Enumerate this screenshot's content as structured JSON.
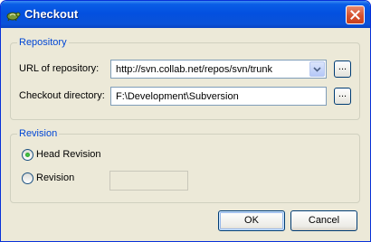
{
  "window": {
    "title": "Checkout",
    "app_icon": "tortoise-svn-icon",
    "close_icon": "close-icon"
  },
  "repository": {
    "legend": "Repository",
    "url_label": "URL of repository:",
    "url_value": "http://svn.collab.net/repos/svn/trunk",
    "url_browse_label": "...",
    "dir_label": "Checkout directory:",
    "dir_value": "F:\\Development\\Subversion",
    "dir_browse_label": "..."
  },
  "revision": {
    "legend": "Revision",
    "head_label": "Head Revision",
    "head_selected": true,
    "revision_label": "Revision",
    "revision_value": ""
  },
  "buttons": {
    "ok": "OK",
    "cancel": "Cancel"
  },
  "colors": {
    "title_bar": "#0a5ee6",
    "group_legend": "#0046d5",
    "dialog_face": "#ece9d8"
  }
}
